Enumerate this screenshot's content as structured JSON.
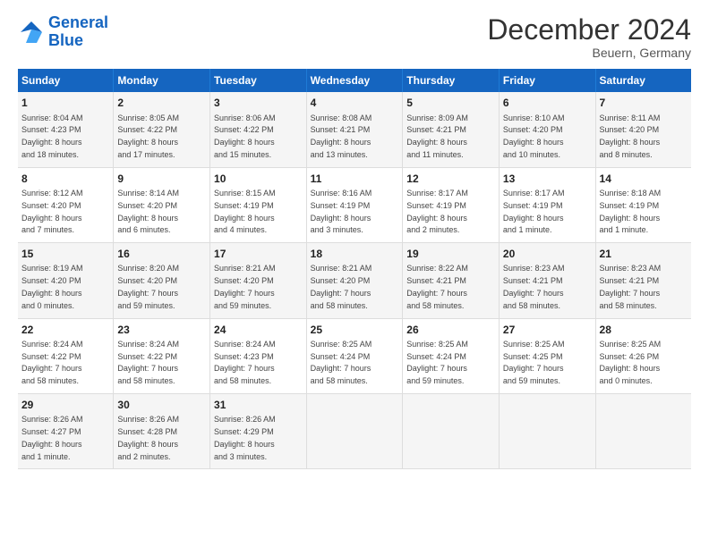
{
  "header": {
    "logo_general": "General",
    "logo_blue": "Blue",
    "month_title": "December 2024",
    "location": "Beuern, Germany"
  },
  "days_of_week": [
    "Sunday",
    "Monday",
    "Tuesday",
    "Wednesday",
    "Thursday",
    "Friday",
    "Saturday"
  ],
  "weeks": [
    [
      {
        "day": "1",
        "info": "Sunrise: 8:04 AM\nSunset: 4:23 PM\nDaylight: 8 hours\nand 18 minutes."
      },
      {
        "day": "2",
        "info": "Sunrise: 8:05 AM\nSunset: 4:22 PM\nDaylight: 8 hours\nand 17 minutes."
      },
      {
        "day": "3",
        "info": "Sunrise: 8:06 AM\nSunset: 4:22 PM\nDaylight: 8 hours\nand 15 minutes."
      },
      {
        "day": "4",
        "info": "Sunrise: 8:08 AM\nSunset: 4:21 PM\nDaylight: 8 hours\nand 13 minutes."
      },
      {
        "day": "5",
        "info": "Sunrise: 8:09 AM\nSunset: 4:21 PM\nDaylight: 8 hours\nand 11 minutes."
      },
      {
        "day": "6",
        "info": "Sunrise: 8:10 AM\nSunset: 4:20 PM\nDaylight: 8 hours\nand 10 minutes."
      },
      {
        "day": "7",
        "info": "Sunrise: 8:11 AM\nSunset: 4:20 PM\nDaylight: 8 hours\nand 8 minutes."
      }
    ],
    [
      {
        "day": "8",
        "info": "Sunrise: 8:12 AM\nSunset: 4:20 PM\nDaylight: 8 hours\nand 7 minutes."
      },
      {
        "day": "9",
        "info": "Sunrise: 8:14 AM\nSunset: 4:20 PM\nDaylight: 8 hours\nand 6 minutes."
      },
      {
        "day": "10",
        "info": "Sunrise: 8:15 AM\nSunset: 4:19 PM\nDaylight: 8 hours\nand 4 minutes."
      },
      {
        "day": "11",
        "info": "Sunrise: 8:16 AM\nSunset: 4:19 PM\nDaylight: 8 hours\nand 3 minutes."
      },
      {
        "day": "12",
        "info": "Sunrise: 8:17 AM\nSunset: 4:19 PM\nDaylight: 8 hours\nand 2 minutes."
      },
      {
        "day": "13",
        "info": "Sunrise: 8:17 AM\nSunset: 4:19 PM\nDaylight: 8 hours\nand 1 minute."
      },
      {
        "day": "14",
        "info": "Sunrise: 8:18 AM\nSunset: 4:19 PM\nDaylight: 8 hours\nand 1 minute."
      }
    ],
    [
      {
        "day": "15",
        "info": "Sunrise: 8:19 AM\nSunset: 4:20 PM\nDaylight: 8 hours\nand 0 minutes."
      },
      {
        "day": "16",
        "info": "Sunrise: 8:20 AM\nSunset: 4:20 PM\nDaylight: 7 hours\nand 59 minutes."
      },
      {
        "day": "17",
        "info": "Sunrise: 8:21 AM\nSunset: 4:20 PM\nDaylight: 7 hours\nand 59 minutes."
      },
      {
        "day": "18",
        "info": "Sunrise: 8:21 AM\nSunset: 4:20 PM\nDaylight: 7 hours\nand 58 minutes."
      },
      {
        "day": "19",
        "info": "Sunrise: 8:22 AM\nSunset: 4:21 PM\nDaylight: 7 hours\nand 58 minutes."
      },
      {
        "day": "20",
        "info": "Sunrise: 8:23 AM\nSunset: 4:21 PM\nDaylight: 7 hours\nand 58 minutes."
      },
      {
        "day": "21",
        "info": "Sunrise: 8:23 AM\nSunset: 4:21 PM\nDaylight: 7 hours\nand 58 minutes."
      }
    ],
    [
      {
        "day": "22",
        "info": "Sunrise: 8:24 AM\nSunset: 4:22 PM\nDaylight: 7 hours\nand 58 minutes."
      },
      {
        "day": "23",
        "info": "Sunrise: 8:24 AM\nSunset: 4:22 PM\nDaylight: 7 hours\nand 58 minutes."
      },
      {
        "day": "24",
        "info": "Sunrise: 8:24 AM\nSunset: 4:23 PM\nDaylight: 7 hours\nand 58 minutes."
      },
      {
        "day": "25",
        "info": "Sunrise: 8:25 AM\nSunset: 4:24 PM\nDaylight: 7 hours\nand 58 minutes."
      },
      {
        "day": "26",
        "info": "Sunrise: 8:25 AM\nSunset: 4:24 PM\nDaylight: 7 hours\nand 59 minutes."
      },
      {
        "day": "27",
        "info": "Sunrise: 8:25 AM\nSunset: 4:25 PM\nDaylight: 7 hours\nand 59 minutes."
      },
      {
        "day": "28",
        "info": "Sunrise: 8:25 AM\nSunset: 4:26 PM\nDaylight: 8 hours\nand 0 minutes."
      }
    ],
    [
      {
        "day": "29",
        "info": "Sunrise: 8:26 AM\nSunset: 4:27 PM\nDaylight: 8 hours\nand 1 minute."
      },
      {
        "day": "30",
        "info": "Sunrise: 8:26 AM\nSunset: 4:28 PM\nDaylight: 8 hours\nand 2 minutes."
      },
      {
        "day": "31",
        "info": "Sunrise: 8:26 AM\nSunset: 4:29 PM\nDaylight: 8 hours\nand 3 minutes."
      },
      {
        "day": "",
        "info": ""
      },
      {
        "day": "",
        "info": ""
      },
      {
        "day": "",
        "info": ""
      },
      {
        "day": "",
        "info": ""
      }
    ]
  ]
}
